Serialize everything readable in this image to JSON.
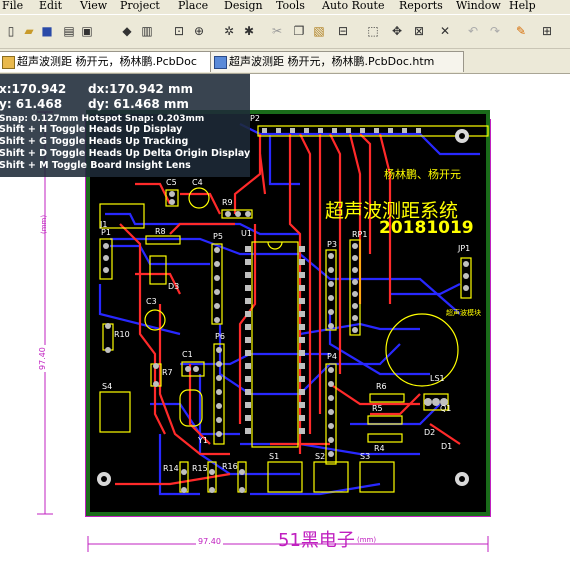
{
  "menu": [
    "File",
    "Edit",
    "View",
    "Project",
    "Place",
    "Design",
    "Tools",
    "Auto Route",
    "Reports",
    "Window",
    "Help"
  ],
  "tabs": [
    {
      "label": "超声波测距 杨开元，杨林鹏.PcbDoc"
    },
    {
      "label": "超声波测距 杨开元，杨林鹏.PcbDoc.htm"
    }
  ],
  "hud": {
    "x": "x:170.942",
    "dx": "dx:170.942 mm",
    "y": "y: 61.468",
    "dy": "dy: 61.468  mm",
    "snap": "Snap: 0.127mm Hotspot Snap: 0.203mm",
    "lines": [
      "Shift + H  Toggle Heads Up Display",
      "Shift + G  Toggle Heads Up Tracking",
      "Shift + D  Toggle Heads Up Delta Origin Display",
      "Shift + M  Toggle Board Insight Lens"
    ]
  },
  "pcb": {
    "names": "杨林鹏、杨开元",
    "title": "超声波测距系统",
    "date": "20181019",
    "footer": "51黑电子",
    "footer_unit": "(mm)",
    "dim_h": "97.40",
    "dim_v": "97.40",
    "unit_v": "(mm)",
    "components": [
      "P2",
      "C5",
      "C4",
      "R9",
      "J1",
      "P1",
      "R8",
      "D3",
      "C3",
      "P5",
      "U1",
      "P3",
      "RP1",
      "JP1",
      "R10",
      "P6",
      "C1",
      "R7",
      "P4",
      "LS1",
      "S4",
      "R6",
      "R5",
      "Q1",
      "R4",
      "D2",
      "D1",
      "R14",
      "R15",
      "R16",
      "S1",
      "S2",
      "S3",
      "Y1"
    ],
    "buzzer_label": "超声波模块"
  },
  "colors": {
    "board_border": "#1a6b1a",
    "board": "#000000",
    "top": "#ff2020",
    "bottom": "#2020ff",
    "silk": "#ffff00",
    "pad": "#c0c0c0",
    "keepout": "#c020c0"
  }
}
